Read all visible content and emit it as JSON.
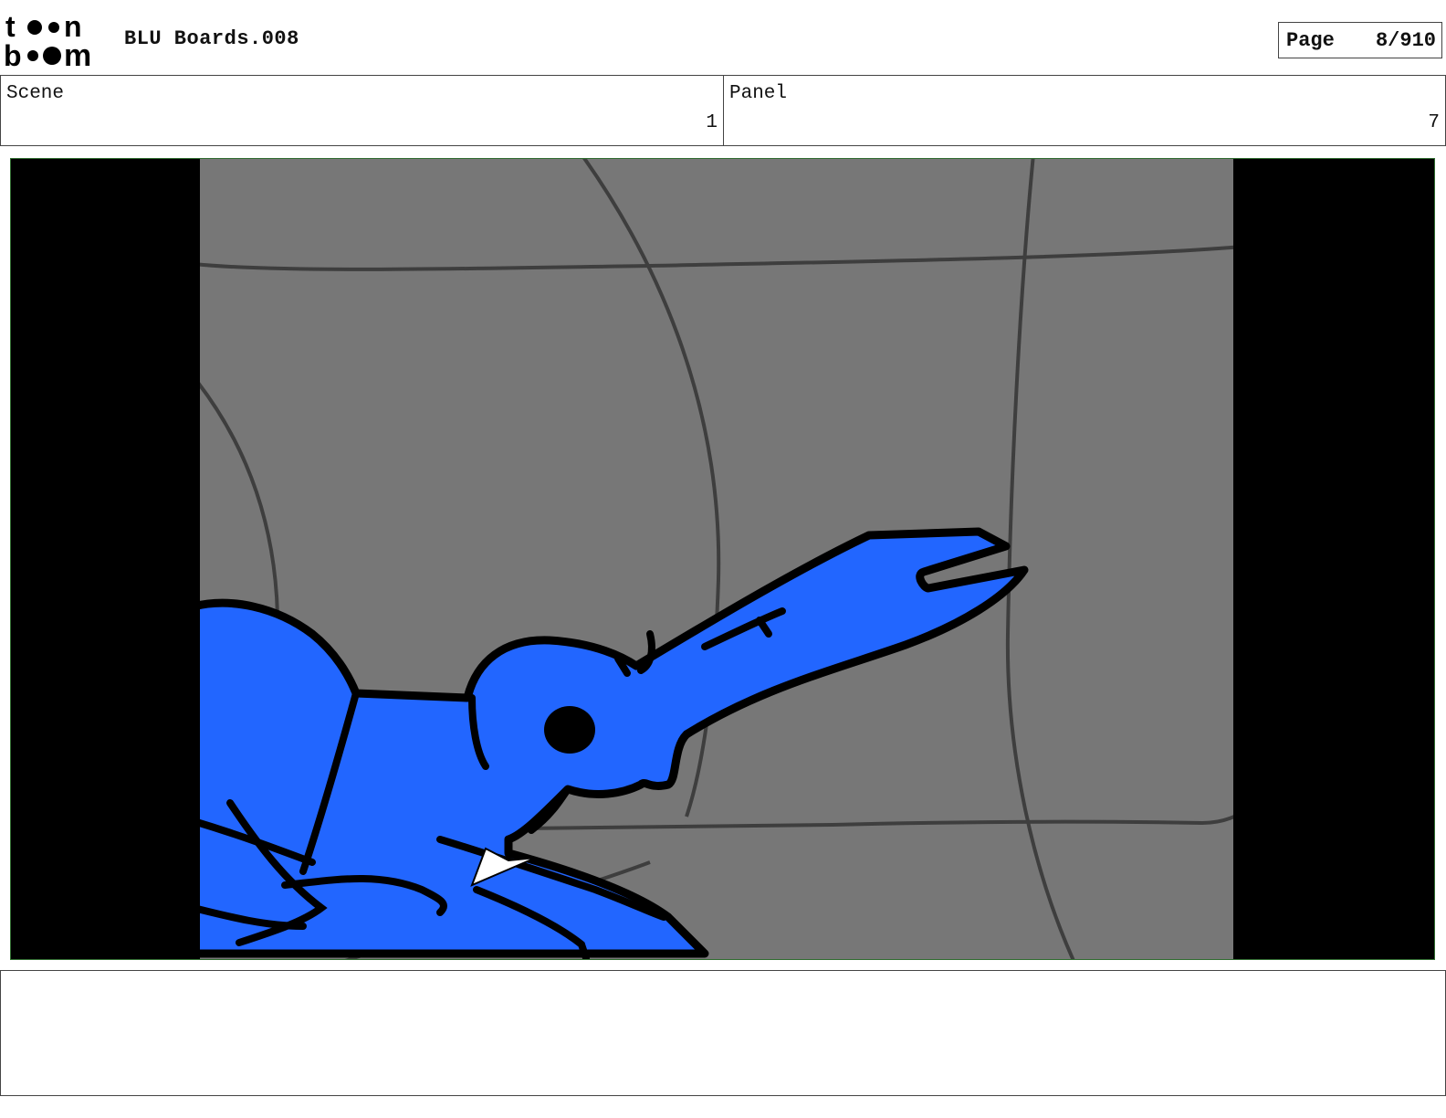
{
  "header": {
    "logo_alt": "toon boom",
    "logo_line1": "t●●n",
    "logo_line2": "b●●m",
    "title": "BLU Boards.008",
    "page_label": "Page",
    "page_value": "8/910"
  },
  "info": {
    "scene_label": "Scene",
    "scene_value": "1",
    "panel_label": "Panel",
    "panel_value": "7"
  },
  "panel_image": {
    "description_icon": "storyboard-drawing",
    "colors": {
      "background": "#777777",
      "character": "#2266ff",
      "outline": "#000000",
      "frame_border": "#2f6b2f",
      "letterbox": "#000000"
    }
  },
  "notes": {
    "text": ""
  }
}
